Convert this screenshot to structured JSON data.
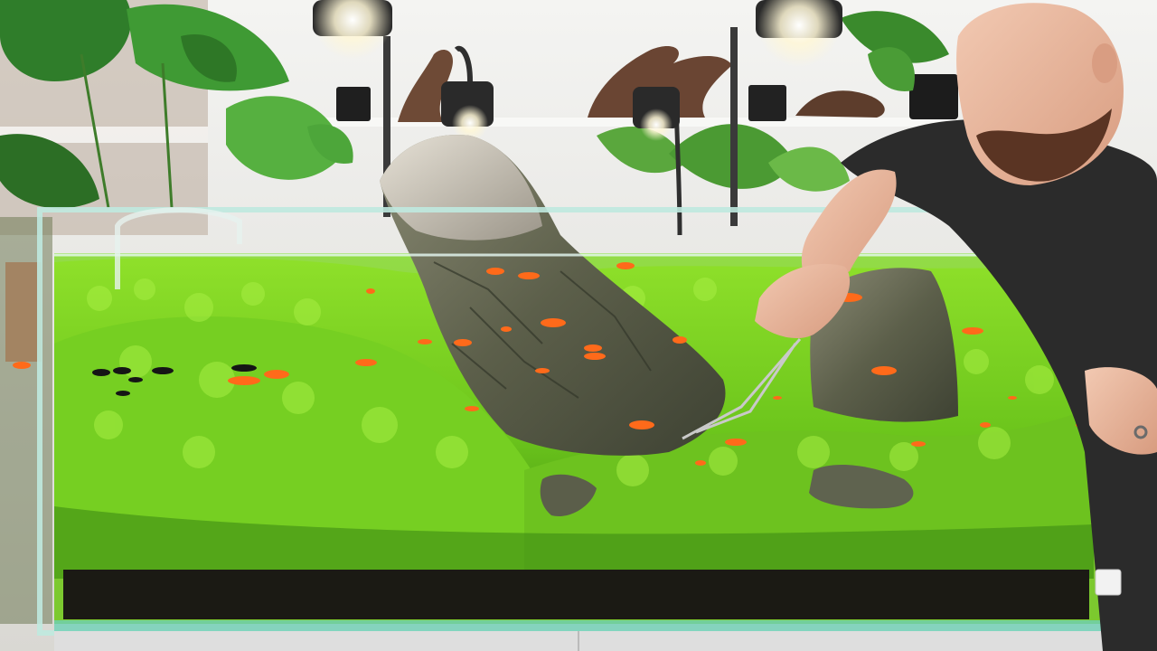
{
  "scene": {
    "subject": "planted-aquarium",
    "colors": {
      "wall": "#eeeeea",
      "plant_carpet": "#7ed321",
      "plant_dark": "#3f8f16",
      "rock": "#5d5f48",
      "fish": "#ff6a1a",
      "glass": "#bfe9df",
      "substrate": "#1b1a14",
      "shirt": "#2b2b2b",
      "skin": "#e9b9a0"
    },
    "fish_count": 28,
    "dark_fish_count": 6,
    "lamp_count": 3
  }
}
